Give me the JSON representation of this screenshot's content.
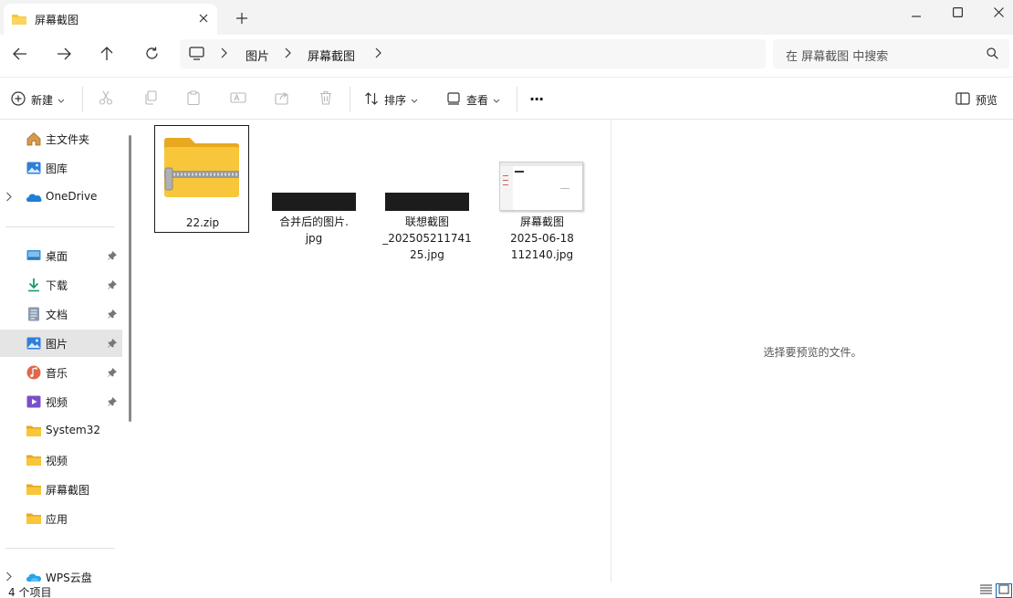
{
  "window": {
    "tab_title": "屏幕截图",
    "tab_icon": "folder-icon",
    "controls": [
      "minimize-icon",
      "maximize-icon",
      "close-icon"
    ]
  },
  "address": {
    "breadcrumbs": [
      "图片",
      "屏幕截图"
    ],
    "search_placeholder": "在 屏幕截图 中搜索"
  },
  "toolbar": {
    "new_label": "新建",
    "sort_label": "排序",
    "view_label": "查看",
    "more_label": "···",
    "preview_label": "预览"
  },
  "sidebar": {
    "items": [
      {
        "label": "主文件夹",
        "icon": "home-icon"
      },
      {
        "label": "图库",
        "icon": "gallery-icon"
      },
      {
        "label": "OneDrive",
        "icon": "onedrive-icon"
      },
      {
        "label": "桌面",
        "icon": "desktop-icon"
      },
      {
        "label": "下载",
        "icon": "download-icon"
      },
      {
        "label": "文档",
        "icon": "document-icon"
      },
      {
        "label": "图片",
        "icon": "pictures-icon"
      },
      {
        "label": "音乐",
        "icon": "music-icon"
      },
      {
        "label": "视频",
        "icon": "video-icon"
      },
      {
        "label": "System32",
        "icon": "folder-icon"
      },
      {
        "label": "视频",
        "icon": "folder-icon"
      },
      {
        "label": "屏幕截图",
        "icon": "folder-icon"
      },
      {
        "label": "应用",
        "icon": "folder-icon"
      },
      {
        "label": "WPS云盘",
        "icon": "cloud-icon"
      }
    ],
    "selected": "图片"
  },
  "files": [
    {
      "name": "22.zip",
      "type": "zip-folder"
    },
    {
      "name_lines": [
        "合并后的图片.",
        "jpg"
      ],
      "type": "image-dark"
    },
    {
      "name_lines": [
        "联想截图",
        "_202505211741",
        "25.jpg"
      ],
      "type": "image-dark"
    },
    {
      "name_lines": [
        "屏幕截图",
        "2025-06-18",
        "112140.jpg"
      ],
      "type": "image-light"
    }
  ],
  "preview": {
    "empty_message": "选择要预览的文件。"
  },
  "status": {
    "item_count": "4 个项目"
  },
  "colors": {
    "accent": "#0067c0",
    "folder_yellow": "#f8c63a",
    "selected_bg": "#e5e5e5"
  }
}
